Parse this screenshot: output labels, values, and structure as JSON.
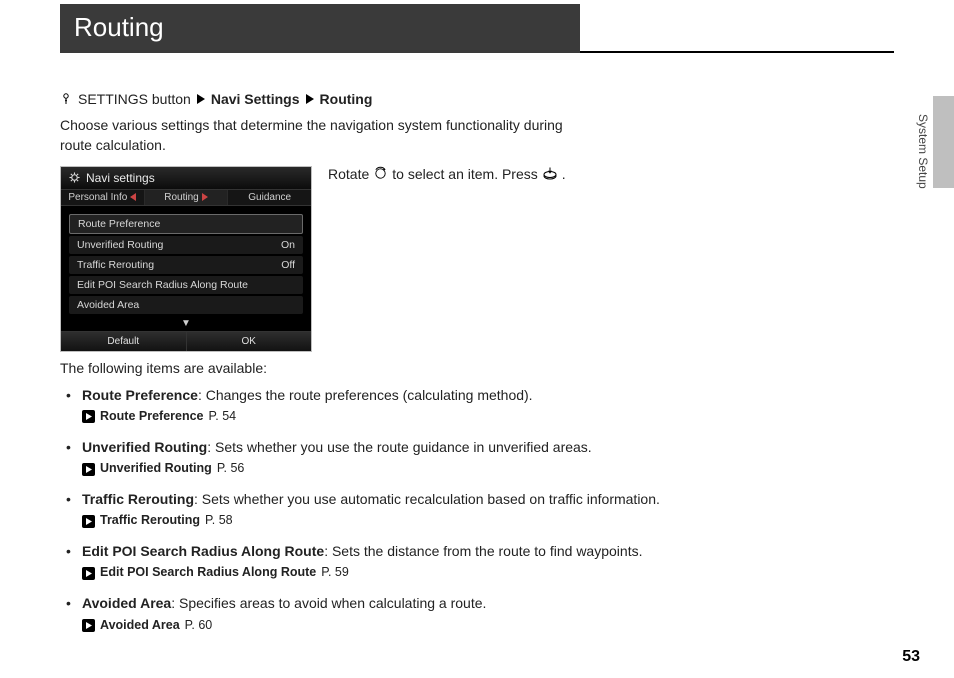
{
  "title": "Routing",
  "breadcrumb": {
    "prefix": "SETTINGS button",
    "step1": "Navi Settings",
    "step2": "Routing"
  },
  "description": "Choose various settings that determine the navigation system functionality during route calculation.",
  "instruction": {
    "p1": "Rotate",
    "p2": "to select an item. Press",
    "p3": "."
  },
  "device": {
    "title": "Navi settings",
    "tabs": [
      "Personal Info",
      "Routing",
      "Guidance"
    ],
    "selected_tab_index": 1,
    "items": [
      {
        "label": "Route Preference",
        "value": "",
        "selected": true
      },
      {
        "label": "Unverified Routing",
        "value": "On"
      },
      {
        "label": "Traffic Rerouting",
        "value": "Off"
      },
      {
        "label": "Edit POI Search Radius Along Route",
        "value": ""
      },
      {
        "label": "Avoided Area",
        "value": ""
      }
    ],
    "buttons": [
      "Default",
      "OK"
    ]
  },
  "following_label": "The following items are available:",
  "items": [
    {
      "title": "Route Preference",
      "desc": ": Changes the route preferences (calculating method).",
      "xref_label": "Route Preference",
      "xref_page": "P. 54"
    },
    {
      "title": "Unverified Routing",
      "desc": ": Sets whether you use the route guidance in unverified areas.",
      "xref_label": "Unverified Routing",
      "xref_page": "P. 56"
    },
    {
      "title": "Traffic Rerouting",
      "desc": ": Sets whether you use automatic recalculation based on traffic information.",
      "xref_label": "Traffic Rerouting",
      "xref_page": "P. 58"
    },
    {
      "title": "Edit POI Search Radius Along Route",
      "desc": ": Sets the distance from the route to find waypoints.",
      "xref_label": "Edit POI Search Radius Along Route",
      "xref_page": "P. 59"
    },
    {
      "title": "Avoided Area",
      "desc": ": Specifies areas to avoid when calculating a route.",
      "xref_label": "Avoided Area",
      "xref_page": "P. 60"
    }
  ],
  "side_label": "System Setup",
  "page_number": "53"
}
